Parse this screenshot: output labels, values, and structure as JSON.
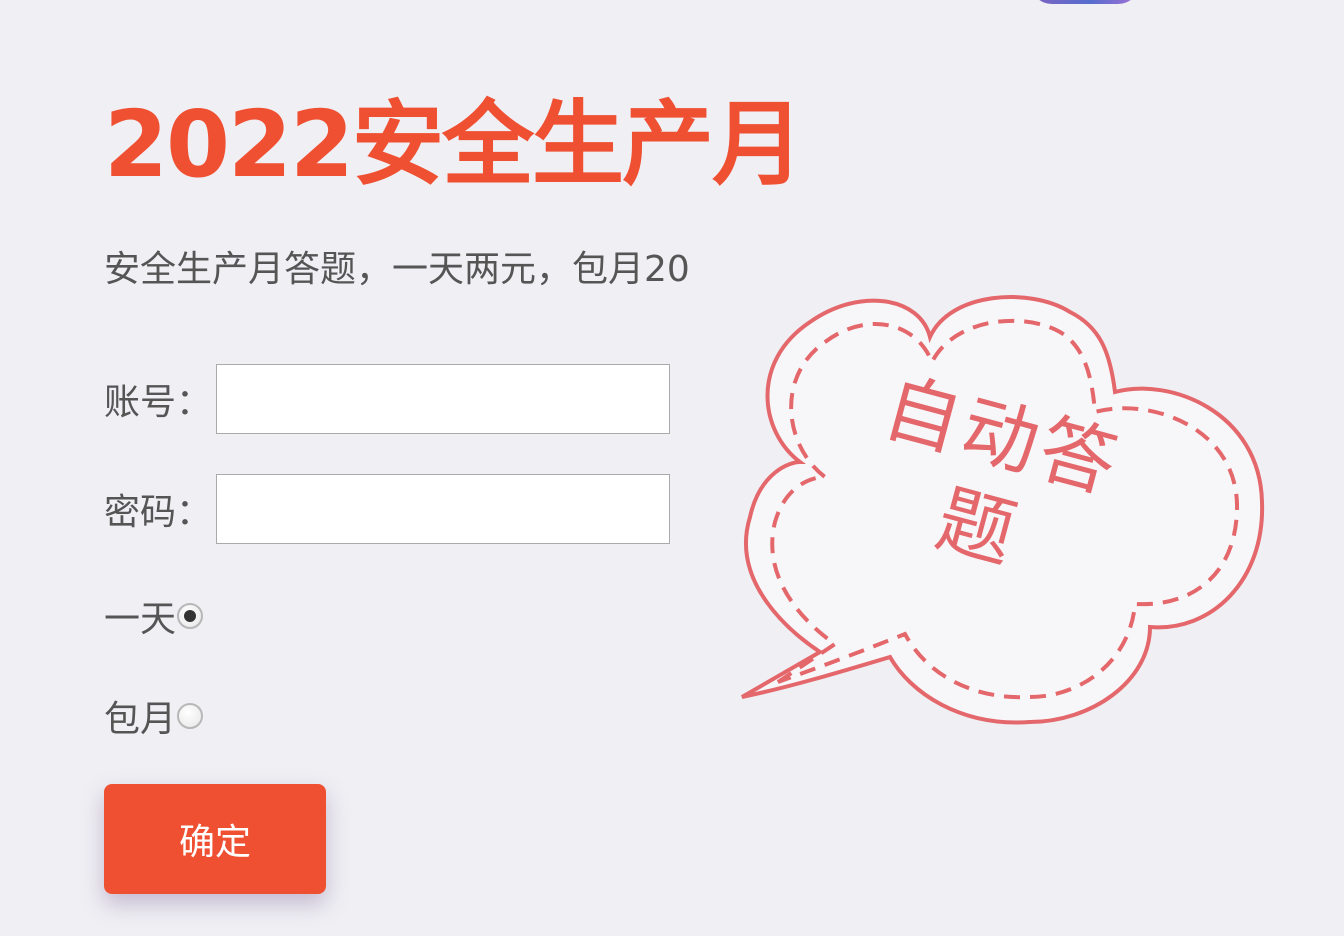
{
  "page": {
    "title": "2022安全生产月",
    "subtitle": "安全生产月答题，一天两元，包月20"
  },
  "form": {
    "account": {
      "label": "账号：",
      "value": "",
      "placeholder": ""
    },
    "password": {
      "label": "密码：",
      "value": "",
      "placeholder": ""
    },
    "plans": [
      {
        "label": "一天",
        "selected": true
      },
      {
        "label": "包月",
        "selected": false
      }
    ],
    "submit_label": "确定"
  },
  "badge": {
    "text": "自动答题"
  },
  "colors": {
    "accent": "#f05032",
    "badge": "#e4676b",
    "background": "#efeff4",
    "text": "#555555"
  }
}
